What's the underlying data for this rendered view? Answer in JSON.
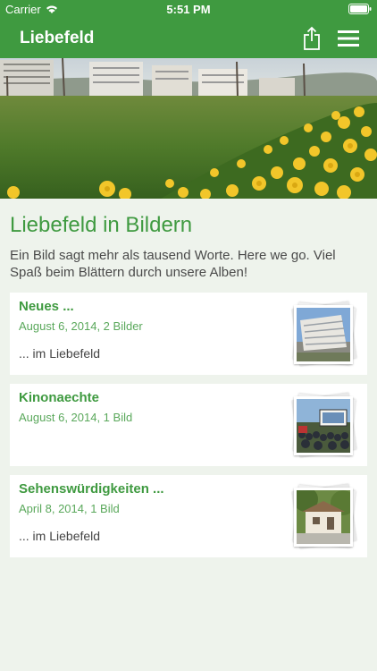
{
  "status_bar": {
    "carrier": "Carrier",
    "time": "5:51 PM"
  },
  "nav": {
    "title": "Liebefeld",
    "share_icon": "share-icon",
    "menu_icon": "hamburger-menu-icon"
  },
  "colors": {
    "brand_green": "#3f9a40",
    "background": "#eef3ec"
  },
  "page": {
    "heading": "Liebefeld in Bildern",
    "intro": "Ein Bild sagt mehr als tausend Worte. Here we go. Viel Spaß beim Blättern durch unsere Alben!"
  },
  "albums": [
    {
      "title": "Neues ...",
      "meta": "August 6, 2014, 2 Bilder",
      "description": "... im Liebefeld"
    },
    {
      "title": "Kinonaechte",
      "meta": "August 6, 2014, 1 Bild",
      "description": ""
    },
    {
      "title": "Sehenswürdigkeiten ...",
      "meta": "April 8, 2014, 1 Bild",
      "description": "... im Liebefeld"
    }
  ]
}
